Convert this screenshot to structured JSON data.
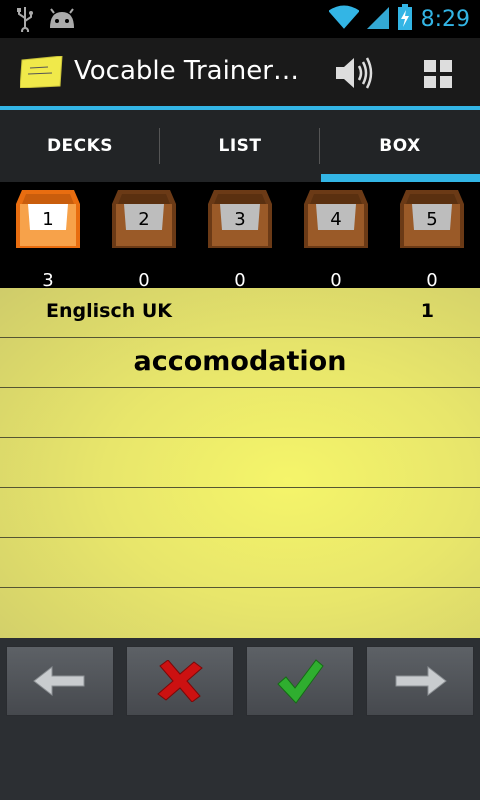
{
  "status_bar": {
    "time": "8:29",
    "icons": [
      "usb-icon",
      "android-debug-icon",
      "wifi-icon",
      "signal-icon",
      "battery-charging-icon"
    ],
    "accent_color": "#33b5e5"
  },
  "action_bar": {
    "title": "Vocable Trainer…",
    "icons": [
      "app-logo",
      "speaker-icon",
      "grid-icon"
    ]
  },
  "tabs": [
    {
      "label": "DECKS",
      "selected": false
    },
    {
      "label": "LIST",
      "selected": false
    },
    {
      "label": "BOX",
      "selected": true
    }
  ],
  "boxes": [
    {
      "number": "1",
      "count": "3",
      "active": true
    },
    {
      "number": "2",
      "count": "0",
      "active": false
    },
    {
      "number": "3",
      "count": "0",
      "active": false
    },
    {
      "number": "4",
      "count": "0",
      "active": false
    },
    {
      "number": "5",
      "count": "0",
      "active": false
    }
  ],
  "card": {
    "deck_name": "Englisch UK",
    "deck_count": "1",
    "word": "accomodation"
  },
  "controls": [
    {
      "name": "previous",
      "icon": "arrow-left-icon"
    },
    {
      "name": "wrong",
      "icon": "red-cross-icon"
    },
    {
      "name": "correct",
      "icon": "green-check-icon"
    },
    {
      "name": "next",
      "icon": "arrow-right-icon"
    }
  ]
}
